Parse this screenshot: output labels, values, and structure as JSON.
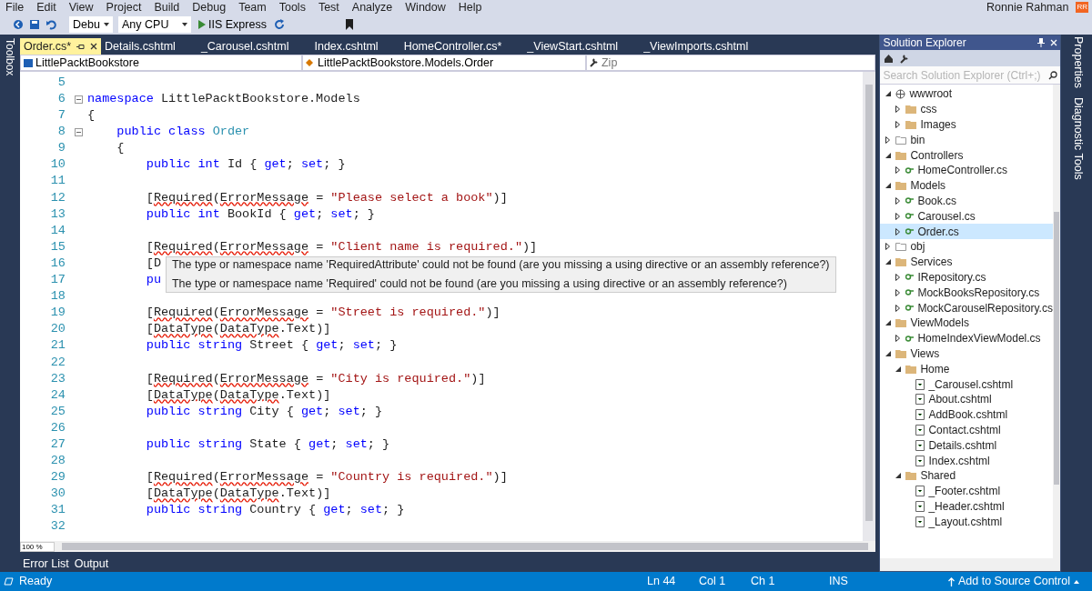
{
  "menu": [
    "File",
    "Edit",
    "View",
    "Project",
    "Build",
    "Debug",
    "Team",
    "Tools",
    "Test",
    "Analyze",
    "Window",
    "Help"
  ],
  "user": {
    "name": "Ronnie Rahman",
    "initials": "RR"
  },
  "toolbar": {
    "config": "Debu",
    "platform": "Any CPU",
    "run": "IIS Express"
  },
  "side_left": "Toolbox",
  "side_right": [
    "Properties",
    "Diagnostic Tools"
  ],
  "tabs": [
    {
      "label": "Order.cs*",
      "selected": true
    },
    {
      "label": "Details.cshtml",
      "selected": false
    },
    {
      "label": "_Carousel.cshtml",
      "selected": false
    },
    {
      "label": "Index.cshtml",
      "selected": false
    },
    {
      "label": "HomeController.cs*",
      "selected": false
    },
    {
      "label": "_ViewStart.cshtml",
      "selected": false
    },
    {
      "label": "_ViewImports.cshtml",
      "selected": false
    }
  ],
  "nav": {
    "project": "LittlePacktBookstore",
    "type": "LittlePacktBookstore.Models.Order",
    "member": "Zip"
  },
  "code": [
    {
      "n": "5"
    },
    {
      "n": "6",
      "fold": true,
      "s": [
        {
          "kind": "kw",
          "t": "namespace"
        },
        {
          "kind": "plain",
          "t": " LittlePacktBookstore.Models"
        }
      ]
    },
    {
      "n": "7",
      "s": [
        {
          "kind": "plain",
          "t": "{"
        }
      ]
    },
    {
      "n": "8",
      "fold": true,
      "s": [
        {
          "kind": "kw",
          "t": "    public class"
        },
        {
          "kind": "type",
          "t": " Order"
        }
      ]
    },
    {
      "n": "9",
      "s": [
        {
          "kind": "plain",
          "t": "    {"
        }
      ]
    },
    {
      "n": "10",
      "s": [
        {
          "kind": "kw",
          "t": "        public int"
        },
        {
          "kind": "plain",
          "t": " Id { "
        },
        {
          "kind": "kw",
          "t": "get"
        },
        {
          "kind": "plain",
          "t": "; "
        },
        {
          "kind": "kw",
          "t": "set"
        },
        {
          "kind": "plain",
          "t": "; }"
        }
      ]
    },
    {
      "n": "11"
    },
    {
      "n": "12",
      "s": [
        {
          "kind": "plain",
          "t": "        ["
        },
        {
          "kind": "err",
          "t": "Required"
        },
        {
          "kind": "plain",
          "t": "("
        },
        {
          "kind": "err",
          "t": "ErrorMessage"
        },
        {
          "kind": "plain",
          "t": " = "
        },
        {
          "kind": "str",
          "t": "\"Please select a book\""
        },
        {
          "kind": "plain",
          "t": ")]"
        }
      ]
    },
    {
      "n": "13",
      "s": [
        {
          "kind": "kw",
          "t": "        public int"
        },
        {
          "kind": "plain",
          "t": " BookId { "
        },
        {
          "kind": "kw",
          "t": "get"
        },
        {
          "kind": "plain",
          "t": "; "
        },
        {
          "kind": "kw",
          "t": "set"
        },
        {
          "kind": "plain",
          "t": "; }"
        }
      ]
    },
    {
      "n": "14"
    },
    {
      "n": "15",
      "s": [
        {
          "kind": "plain",
          "t": "        ["
        },
        {
          "kind": "err",
          "t": "Required"
        },
        {
          "kind": "plain",
          "t": "("
        },
        {
          "kind": "err",
          "t": "ErrorMessage"
        },
        {
          "kind": "plain",
          "t": " = "
        },
        {
          "kind": "str",
          "t": "\"Client name is required.\""
        },
        {
          "kind": "plain",
          "t": ")]"
        }
      ]
    },
    {
      "n": "16",
      "s": [
        {
          "kind": "plain",
          "t": "        [D"
        }
      ]
    },
    {
      "n": "17",
      "s": [
        {
          "kind": "kw",
          "t": "        pu"
        }
      ]
    },
    {
      "n": "18"
    },
    {
      "n": "19",
      "s": [
        {
          "kind": "plain",
          "t": "        ["
        },
        {
          "kind": "err",
          "t": "Required"
        },
        {
          "kind": "plain",
          "t": "("
        },
        {
          "kind": "err",
          "t": "ErrorMessage"
        },
        {
          "kind": "plain",
          "t": " = "
        },
        {
          "kind": "str",
          "t": "\"Street is required.\""
        },
        {
          "kind": "plain",
          "t": ")]"
        }
      ]
    },
    {
      "n": "20",
      "s": [
        {
          "kind": "plain",
          "t": "        ["
        },
        {
          "kind": "err",
          "t": "DataType"
        },
        {
          "kind": "plain",
          "t": "("
        },
        {
          "kind": "err",
          "t": "DataType"
        },
        {
          "kind": "plain",
          "t": ".Text)]"
        }
      ]
    },
    {
      "n": "21",
      "s": [
        {
          "kind": "kw",
          "t": "        public string"
        },
        {
          "kind": "plain",
          "t": " Street { "
        },
        {
          "kind": "kw",
          "t": "get"
        },
        {
          "kind": "plain",
          "t": "; "
        },
        {
          "kind": "kw",
          "t": "set"
        },
        {
          "kind": "plain",
          "t": "; }"
        }
      ]
    },
    {
      "n": "22"
    },
    {
      "n": "23",
      "s": [
        {
          "kind": "plain",
          "t": "        ["
        },
        {
          "kind": "err",
          "t": "Required"
        },
        {
          "kind": "plain",
          "t": "("
        },
        {
          "kind": "err",
          "t": "ErrorMessage"
        },
        {
          "kind": "plain",
          "t": " = "
        },
        {
          "kind": "str",
          "t": "\"City is required.\""
        },
        {
          "kind": "plain",
          "t": ")]"
        }
      ]
    },
    {
      "n": "24",
      "s": [
        {
          "kind": "plain",
          "t": "        ["
        },
        {
          "kind": "err",
          "t": "DataType"
        },
        {
          "kind": "plain",
          "t": "("
        },
        {
          "kind": "err",
          "t": "DataType"
        },
        {
          "kind": "plain",
          "t": ".Text)]"
        }
      ]
    },
    {
      "n": "25",
      "s": [
        {
          "kind": "kw",
          "t": "        public string"
        },
        {
          "kind": "plain",
          "t": " City { "
        },
        {
          "kind": "kw",
          "t": "get"
        },
        {
          "kind": "plain",
          "t": "; "
        },
        {
          "kind": "kw",
          "t": "set"
        },
        {
          "kind": "plain",
          "t": "; }"
        }
      ]
    },
    {
      "n": "26"
    },
    {
      "n": "27",
      "s": [
        {
          "kind": "kw",
          "t": "        public string"
        },
        {
          "kind": "plain",
          "t": " State { "
        },
        {
          "kind": "kw",
          "t": "get"
        },
        {
          "kind": "plain",
          "t": "; "
        },
        {
          "kind": "kw",
          "t": "set"
        },
        {
          "kind": "plain",
          "t": "; }"
        }
      ]
    },
    {
      "n": "28"
    },
    {
      "n": "29",
      "s": [
        {
          "kind": "plain",
          "t": "        ["
        },
        {
          "kind": "err",
          "t": "Required"
        },
        {
          "kind": "plain",
          "t": "("
        },
        {
          "kind": "err",
          "t": "ErrorMessage"
        },
        {
          "kind": "plain",
          "t": " = "
        },
        {
          "kind": "str",
          "t": "\"Country is required.\""
        },
        {
          "kind": "plain",
          "t": ")]"
        }
      ]
    },
    {
      "n": "30",
      "s": [
        {
          "kind": "plain",
          "t": "        ["
        },
        {
          "kind": "err",
          "t": "DataType"
        },
        {
          "kind": "plain",
          "t": "("
        },
        {
          "kind": "err",
          "t": "DataType"
        },
        {
          "kind": "plain",
          "t": ".Text)]"
        }
      ]
    },
    {
      "n": "31",
      "s": [
        {
          "kind": "kw",
          "t": "        public string"
        },
        {
          "kind": "plain",
          "t": " Country { "
        },
        {
          "kind": "kw",
          "t": "get"
        },
        {
          "kind": "plain",
          "t": "; "
        },
        {
          "kind": "kw",
          "t": "set"
        },
        {
          "kind": "plain",
          "t": "; }"
        }
      ]
    },
    {
      "n": "32"
    }
  ],
  "tooltip": [
    "The type or namespace name 'RequiredAttribute' could not be found (are you missing a using directive or an assembly reference?)",
    "The type or namespace name 'Required' could not be found (are you missing a using directive or an assembly reference?)"
  ],
  "zoom": "100 %",
  "solution_explorer": {
    "title": "Solution Explorer",
    "search": {
      "placeholder": "Search Solution Explorer (Ctrl+;)"
    },
    "tree": [
      {
        "label": "wwwroot",
        "kind": "web",
        "expanded": true,
        "selected": false,
        "children": [
          {
            "label": "css",
            "kind": "folder",
            "expanded": false,
            "selected": false
          },
          {
            "label": "Images",
            "kind": "folder",
            "expanded": false,
            "selected": false
          }
        ]
      },
      {
        "label": "bin",
        "kind": "hidden",
        "expanded": false,
        "selected": false
      },
      {
        "label": "Controllers",
        "kind": "folder",
        "expanded": true,
        "selected": false,
        "children": [
          {
            "label": "HomeController.cs",
            "kind": "cs",
            "expanded": false,
            "selected": false
          }
        ]
      },
      {
        "label": "Models",
        "kind": "folder",
        "expanded": true,
        "selected": false,
        "children": [
          {
            "label": "Book.cs",
            "kind": "cs",
            "expanded": false,
            "selected": false
          },
          {
            "label": "Carousel.cs",
            "kind": "cs",
            "expanded": false,
            "selected": false
          },
          {
            "label": "Order.cs",
            "kind": "cs",
            "expanded": false,
            "selected": true
          }
        ]
      },
      {
        "label": "obj",
        "kind": "hidden",
        "expanded": false,
        "selected": false
      },
      {
        "label": "Services",
        "kind": "folder",
        "expanded": true,
        "selected": false,
        "children": [
          {
            "label": "IRepository.cs",
            "kind": "cs",
            "expanded": false,
            "selected": false
          },
          {
            "label": "MockBooksRepository.cs",
            "kind": "cs",
            "expanded": false,
            "selected": false
          },
          {
            "label": "MockCarouselRepository.cs",
            "kind": "cs",
            "expanded": false,
            "selected": false
          }
        ]
      },
      {
        "label": "ViewModels",
        "kind": "folder",
        "expanded": true,
        "selected": false,
        "children": [
          {
            "label": "HomeIndexViewModel.cs",
            "kind": "cs",
            "expanded": false,
            "selected": false
          }
        ]
      },
      {
        "label": "Views",
        "kind": "folder",
        "expanded": true,
        "selected": false,
        "children": [
          {
            "label": "Home",
            "kind": "folder",
            "expanded": true,
            "selected": false,
            "children": [
              {
                "label": "_Carousel.cshtml",
                "kind": "page",
                "selected": false
              },
              {
                "label": "About.cshtml",
                "kind": "page",
                "selected": false
              },
              {
                "label": "AddBook.cshtml",
                "kind": "page",
                "selected": false
              },
              {
                "label": "Contact.cshtml",
                "kind": "page",
                "selected": false
              },
              {
                "label": "Details.cshtml",
                "kind": "page",
                "selected": false
              },
              {
                "label": "Index.cshtml",
                "kind": "page",
                "selected": false
              }
            ]
          },
          {
            "label": "Shared",
            "kind": "folder",
            "expanded": true,
            "selected": false,
            "children": [
              {
                "label": "_Footer.cshtml",
                "kind": "page",
                "selected": false
              },
              {
                "label": "_Header.cshtml",
                "kind": "page",
                "selected": false
              },
              {
                "label": "_Layout.cshtml",
                "kind": "page",
                "selected": false
              }
            ]
          }
        ]
      }
    ]
  },
  "bottom_tabs": [
    "Error List",
    "Output"
  ],
  "status": {
    "state": "Ready",
    "line": "Ln 44",
    "col": "Col 1",
    "ch": "Ch 1",
    "mode": "INS",
    "source_control": "Add to Source Control"
  }
}
